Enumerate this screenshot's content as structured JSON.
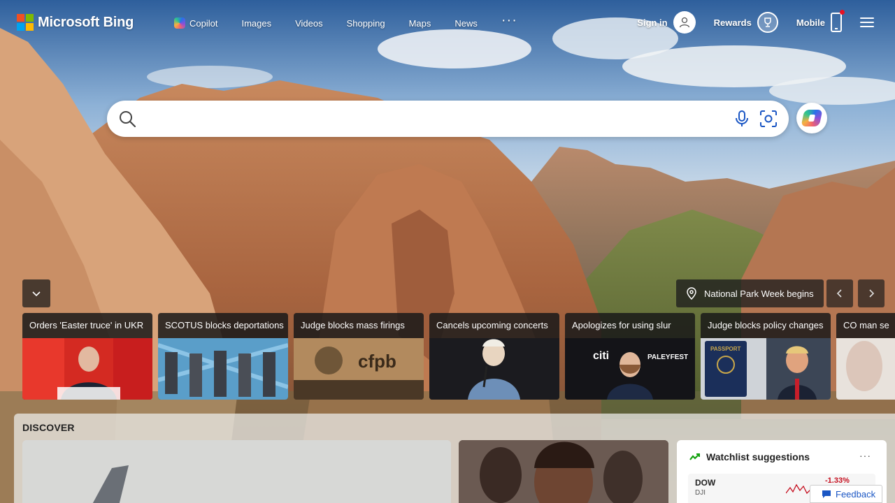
{
  "brand": {
    "name": "Microsoft Bing"
  },
  "nav": {
    "items": [
      {
        "label": "Copilot",
        "icon": "copilot-icon"
      },
      {
        "label": "Images"
      },
      {
        "label": "Videos"
      },
      {
        "label": "Shopping"
      },
      {
        "label": "Maps"
      },
      {
        "label": "News"
      }
    ],
    "more": "···"
  },
  "header_right": {
    "sign_in": "Sign in",
    "rewards": "Rewards",
    "mobile": "Mobile"
  },
  "search": {
    "value": "",
    "placeholder": "",
    "icons": [
      "search-icon",
      "microphone-icon",
      "visual-search-icon",
      "copilot-icon"
    ]
  },
  "background": {
    "caption": "National Park Week begins"
  },
  "news": [
    {
      "title": "Orders 'Easter truce' in UKR"
    },
    {
      "title": "SCOTUS blocks deportations"
    },
    {
      "title": "Judge blocks mass firings"
    },
    {
      "title": "Cancels upcoming concerts"
    },
    {
      "title": "Apologizes for using slur"
    },
    {
      "title": "Judge blocks policy changes"
    },
    {
      "title": "CO man se"
    }
  ],
  "news_image_text": {
    "cfpb": "cfpb",
    "citi": "citi",
    "paleyfest": "PALEYFEST",
    "passport": "PASSPORT"
  },
  "discover": {
    "title": "DISCOVER",
    "watchlist": {
      "title": "Watchlist suggestions",
      "more": "···",
      "row": {
        "symbol": "DOW",
        "name": "DJI",
        "change": "-1.33%"
      }
    }
  },
  "feedback": {
    "label": "Feedback"
  },
  "colors": {
    "accent": "#1a56c4",
    "negative": "#c50f1f",
    "watchlist_green": "#13a10e"
  }
}
